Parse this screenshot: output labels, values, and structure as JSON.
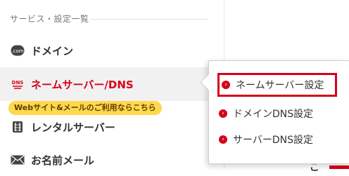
{
  "sidebar": {
    "section_title": "サービス・設定一覧",
    "items": [
      {
        "label": "ドメイン",
        "icon": "com-domain-icon"
      },
      {
        "label": "ネームサーバー/DNS",
        "icon": "dns-icon"
      },
      {
        "label": "レンタルサーバー",
        "icon": "server-icon"
      },
      {
        "label": "お名前メール",
        "icon": "mail-icon"
      }
    ],
    "hint_badge": "Webサイト&メールのご利用ならこちら"
  },
  "popover": {
    "items": [
      {
        "label": "ネームサーバー設定"
      },
      {
        "label": "ドメインDNS設定"
      },
      {
        "label": "サーバーDNS設定"
      }
    ]
  },
  "background": {
    "fragment": "ご"
  },
  "colors": {
    "accent": "#d7001a",
    "badge": "#ffd84d",
    "text": "#333333"
  },
  "icons": {
    "domain": ".com",
    "dns": "DNS"
  }
}
